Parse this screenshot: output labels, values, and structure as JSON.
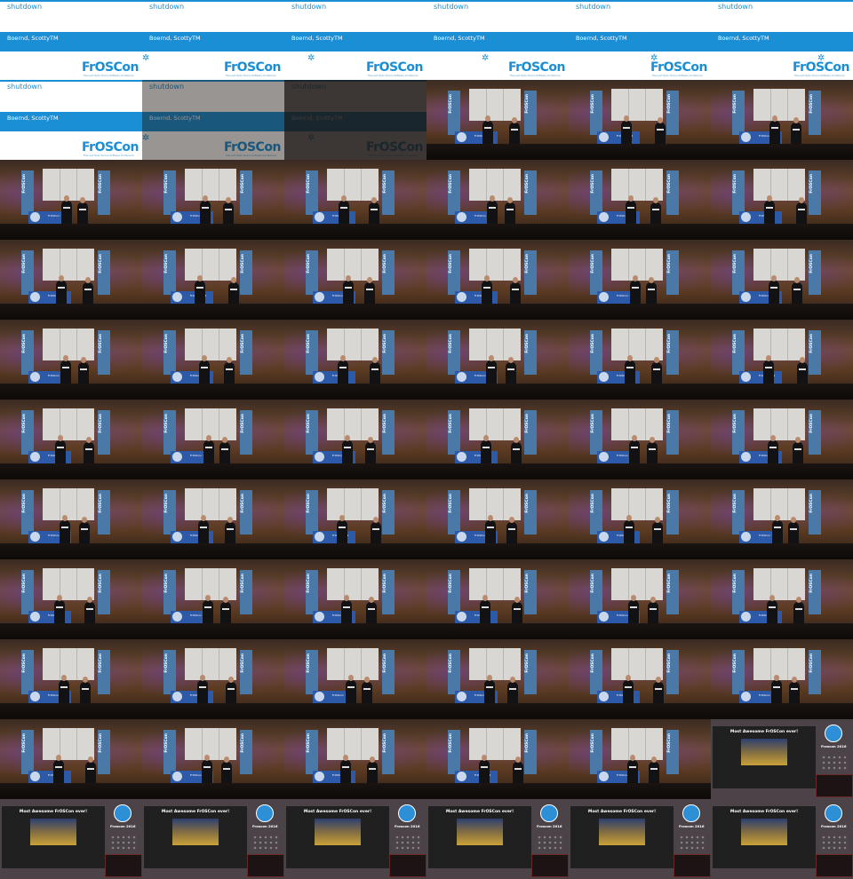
{
  "layout": {
    "columns": 6,
    "rows": 11
  },
  "colors": {
    "accent": "#1a8fd6",
    "band": "#1a8fd6",
    "banner": "#4a79a8",
    "desk": "#2d5aa8",
    "closing_bg": "#4b4348"
  },
  "title_slide": {
    "title": "shutdown",
    "speaker": "Boernd, ScottyTM",
    "logo": "FrOSCon",
    "logo_subtitle": "Free and Open Source Software Conference",
    "gear_icon": "gear-icon"
  },
  "stage": {
    "banner_text": "FrOSCon",
    "desk_text": "FrOSCon '11"
  },
  "closing": {
    "title": "Most Awesome FrOSCon ever!",
    "badge_text": "Froscon 2016",
    "badge_icon": "tree-icon"
  },
  "frames": [
    "title",
    "title",
    "title",
    "title",
    "title",
    "title",
    "title",
    "title-fade1",
    "title-fade2",
    "stage",
    "stage",
    "stage",
    "stage",
    "stage",
    "stage",
    "stage",
    "stage",
    "stage",
    "stage",
    "stage",
    "stage",
    "stage",
    "stage",
    "stage",
    "stage",
    "stage",
    "stage",
    "stage",
    "stage",
    "stage",
    "stage",
    "stage",
    "stage",
    "stage",
    "stage",
    "stage",
    "stage",
    "stage",
    "stage",
    "stage",
    "stage",
    "stage",
    "stage",
    "stage",
    "stage",
    "stage",
    "stage",
    "stage",
    "stage",
    "stage",
    "stage",
    "stage",
    "stage",
    "stage",
    "stage",
    "stage",
    "stage",
    "stage",
    "stage",
    "closing",
    "closing",
    "closing",
    "closing",
    "closing",
    "closing",
    "closing"
  ]
}
